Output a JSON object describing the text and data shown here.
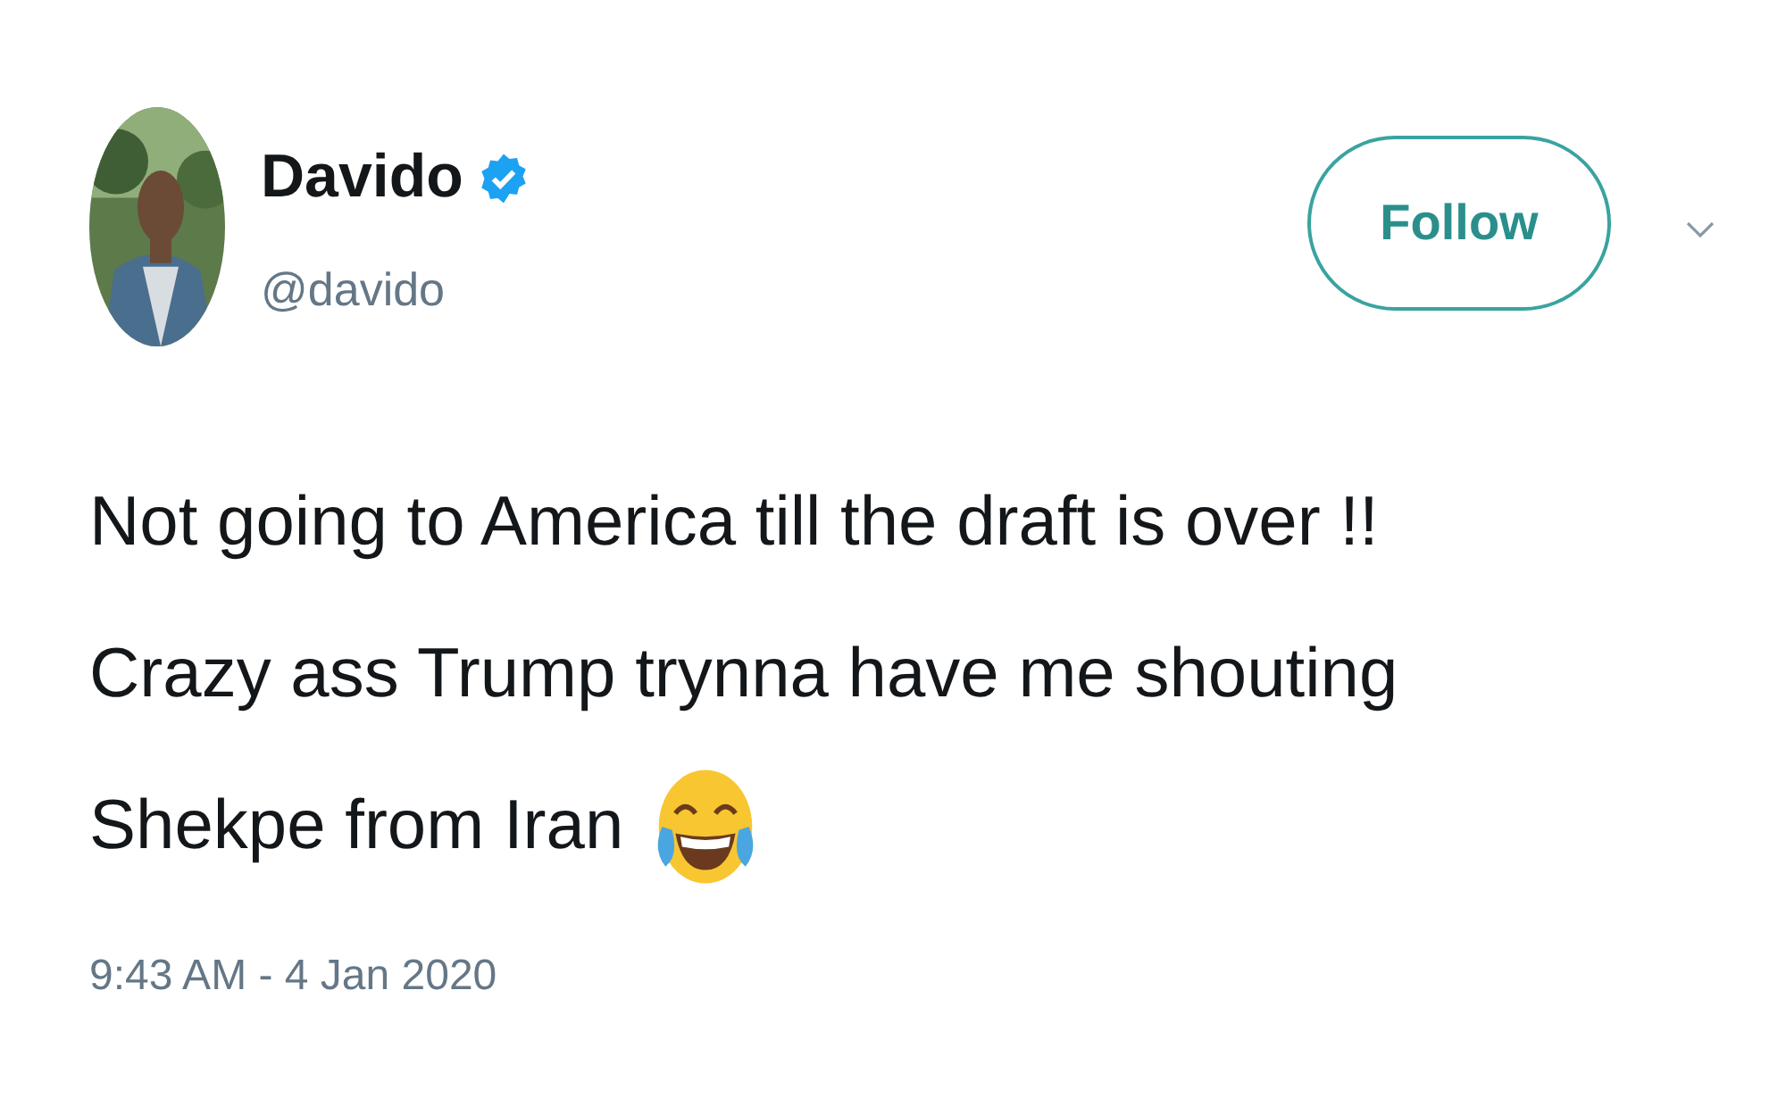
{
  "author": {
    "name": "Davido",
    "verified": true,
    "handle": "@davido"
  },
  "follow_button": {
    "label": "Follow"
  },
  "tweet": {
    "lines": [
      "Not going to America till the draft is over !!",
      "Crazy ass Trump trynna have me shouting",
      "Shekpe from Iran"
    ]
  },
  "timestamp": "9:43 AM - 4 Jan 2020"
}
